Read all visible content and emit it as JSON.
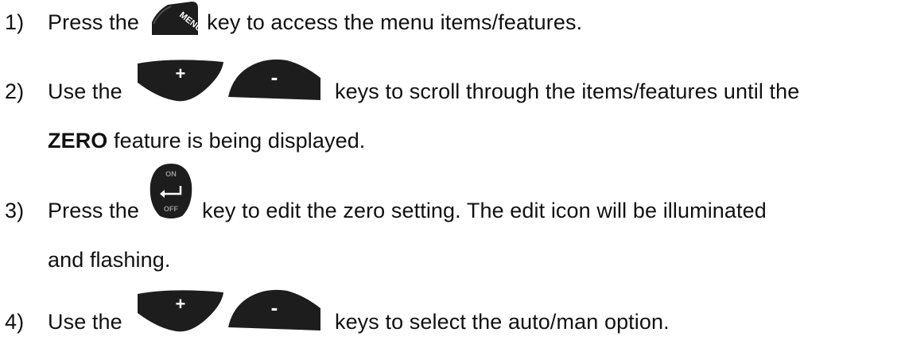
{
  "steps": [
    {
      "num": "1)",
      "pre": "Press the",
      "post": "key to access the menu items/features."
    },
    {
      "num": "2)",
      "pre": "Use the",
      "post": "keys to scroll through the items/features until the",
      "cont_bold": "ZERO",
      "cont_rest": " feature is being displayed."
    },
    {
      "num": "3)",
      "pre": "Press the",
      "post": "key to edit the zero setting.  The edit icon will be illuminated",
      "cont": "and flashing."
    },
    {
      "num": "4)",
      "pre": "Use the",
      "post": "keys to select the auto/man option."
    }
  ],
  "keys": {
    "menu": {
      "label": "MENU",
      "icon": "menu-key-icon"
    },
    "plus": {
      "label": "+",
      "icon": "plus-key-icon"
    },
    "minus": {
      "label": "-",
      "icon": "minus-key-icon"
    },
    "onoff": {
      "label_on": "ON",
      "label_off": "OFF",
      "icon": "enter-key-icon"
    }
  },
  "colors": {
    "key_dark": "#1d1d1d",
    "key_text": "#ffffff",
    "key_small_text": "#9a9a9a"
  }
}
